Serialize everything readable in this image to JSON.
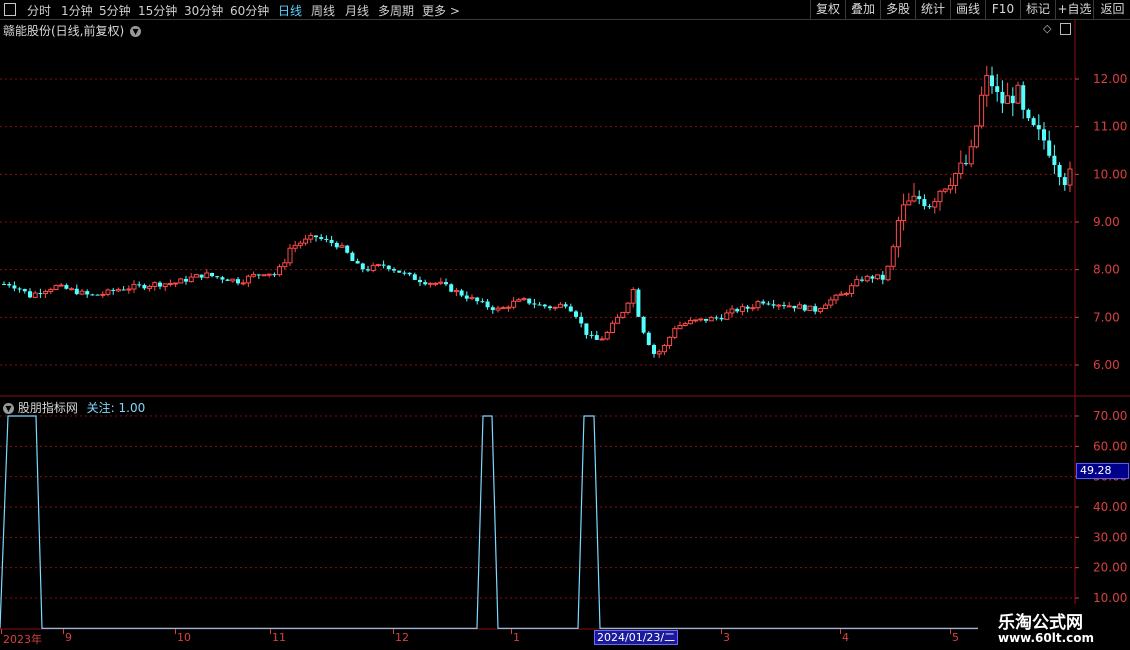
{
  "toolbar": {
    "periods": [
      "分时",
      "1分钟",
      "5分钟",
      "15分钟",
      "30分钟",
      "60分钟",
      "日线",
      "周线",
      "月线",
      "多周期",
      "更多 >"
    ],
    "active_period": "日线",
    "buttons": [
      "复权",
      "叠加",
      "多股",
      "统计",
      "画线",
      "F10",
      "标记",
      "+自选",
      "返回"
    ]
  },
  "stock": {
    "title": "赣能股份(日线,前复权)"
  },
  "indicator": {
    "name": "股朋指标网",
    "value_label": "关注: 1.00",
    "current_value": "49.28"
  },
  "price_axis": [
    "12.00",
    "11.00",
    "10.00",
    "9.00",
    "8.00",
    "7.00",
    "6.00"
  ],
  "indicator_axis": [
    "70.00",
    "60.00",
    "50.00",
    "40.00",
    "30.00",
    "20.00",
    "10.00"
  ],
  "date_axis": [
    "2023年",
    "9",
    "10",
    "11",
    "12",
    "1",
    "2",
    "3",
    "4",
    "5"
  ],
  "cursor_date": "2024/01/23/二",
  "watermark": {
    "title": "乐淘公式网",
    "url": "www.60lt.com"
  },
  "colors": {
    "up": "#ff4a4a",
    "down": "#54ffff",
    "grid": "#8a1010",
    "indicator_line": "#7fd8ff",
    "axis_text": "#d84040"
  },
  "chart_data": [
    {
      "type": "candlestick",
      "title": "赣能股份(日线,前复权)",
      "ylim": [
        5.7,
        12.9
      ],
      "x_range": [
        "2023-08",
        "2024-05"
      ],
      "price_path": [
        [
          0,
          7.7
        ],
        [
          10,
          7.7
        ],
        [
          20,
          7.6
        ],
        [
          30,
          7.45
        ],
        [
          40,
          7.55
        ],
        [
          55,
          7.65
        ],
        [
          65,
          7.6
        ],
        [
          75,
          7.55
        ],
        [
          90,
          7.45
        ],
        [
          105,
          7.5
        ],
        [
          120,
          7.6
        ],
        [
          140,
          7.65
        ],
        [
          155,
          7.7
        ],
        [
          175,
          7.72
        ],
        [
          195,
          7.85
        ],
        [
          205,
          7.9
        ],
        [
          215,
          7.85
        ],
        [
          230,
          7.8
        ],
        [
          240,
          7.75
        ],
        [
          250,
          7.85
        ],
        [
          265,
          7.95
        ],
        [
          275,
          7.9
        ],
        [
          283,
          8.1
        ],
        [
          290,
          8.45
        ],
        [
          298,
          8.55
        ],
        [
          305,
          8.6
        ],
        [
          315,
          8.7
        ],
        [
          325,
          8.6
        ],
        [
          335,
          8.55
        ],
        [
          345,
          8.4
        ],
        [
          355,
          8.1
        ],
        [
          365,
          8.0
        ],
        [
          375,
          8.05
        ],
        [
          385,
          8.1
        ],
        [
          395,
          8.0
        ],
        [
          410,
          7.85
        ],
        [
          425,
          7.75
        ],
        [
          440,
          7.7
        ],
        [
          455,
          7.55
        ],
        [
          470,
          7.4
        ],
        [
          485,
          7.25
        ],
        [
          500,
          7.15
        ],
        [
          512,
          7.3
        ],
        [
          525,
          7.35
        ],
        [
          540,
          7.25
        ],
        [
          555,
          7.2
        ],
        [
          565,
          7.3
        ],
        [
          575,
          7.1
        ],
        [
          585,
          6.7
        ],
        [
          595,
          6.5
        ],
        [
          605,
          6.6
        ],
        [
          615,
          6.9
        ],
        [
          625,
          7.2
        ],
        [
          633,
          7.6
        ],
        [
          640,
          6.9
        ],
        [
          648,
          6.5
        ],
        [
          655,
          6.2
        ],
        [
          665,
          6.4
        ],
        [
          675,
          6.8
        ],
        [
          690,
          6.9
        ],
        [
          705,
          6.95
        ],
        [
          720,
          7.0
        ],
        [
          735,
          7.15
        ],
        [
          750,
          7.2
        ],
        [
          760,
          7.35
        ],
        [
          775,
          7.3
        ],
        [
          790,
          7.25
        ],
        [
          805,
          7.2
        ],
        [
          815,
          7.15
        ],
        [
          825,
          7.3
        ],
        [
          840,
          7.45
        ],
        [
          850,
          7.6
        ],
        [
          860,
          7.8
        ],
        [
          875,
          7.85
        ],
        [
          885,
          7.8
        ],
        [
          895,
          8.6
        ],
        [
          900,
          9.2
        ],
        [
          910,
          9.4
        ],
        [
          920,
          9.5
        ],
        [
          930,
          9.4
        ],
        [
          940,
          9.7
        ],
        [
          950,
          9.9
        ],
        [
          960,
          10.1
        ],
        [
          970,
          10.3
        ],
        [
          978,
          11.2
        ],
        [
          985,
          12.0
        ],
        [
          992,
          11.9
        ],
        [
          1000,
          11.5
        ],
        [
          1010,
          11.6
        ],
        [
          1018,
          11.7
        ],
        [
          1025,
          11.1
        ],
        [
          1035,
          10.9
        ],
        [
          1045,
          10.7
        ],
        [
          1055,
          10.3
        ],
        [
          1065,
          9.9
        ],
        [
          1072,
          10.0
        ]
      ]
    },
    {
      "type": "line",
      "title": "股朋指标网",
      "ylim": [
        0,
        75
      ],
      "x": [
        0,
        8,
        36,
        42,
        477,
        483,
        492,
        498,
        578,
        584,
        594,
        600,
        1075
      ],
      "values": [
        0,
        70,
        70,
        0,
        0,
        70,
        70,
        0,
        0,
        70,
        70,
        0,
        0
      ]
    }
  ]
}
